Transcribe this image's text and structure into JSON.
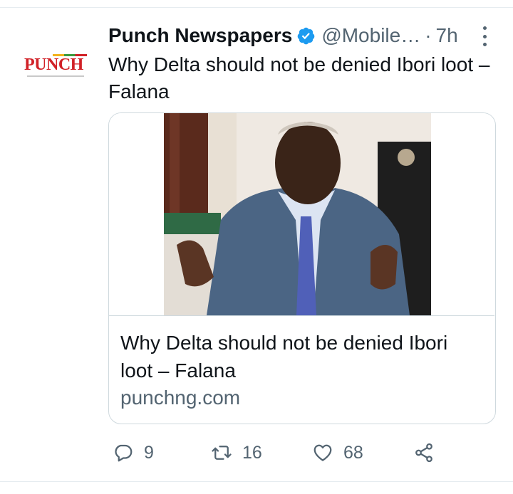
{
  "tweet": {
    "author_name": "Punch Newspapers",
    "handle": "@Mobile…",
    "separator": "·",
    "time": "7h",
    "text": "Why Delta should not be denied Ibori loot – Falana",
    "avatar_logo_text": "PUNCH"
  },
  "card": {
    "title": "Why Delta should not be denied Ibori loot – Falana",
    "domain": "punchng.com"
  },
  "actions": {
    "reply_count": "9",
    "retweet_count": "16",
    "like_count": "68"
  },
  "icons": {
    "verified": "verified-badge-icon",
    "more": "more-vertical-icon",
    "reply": "reply-icon",
    "retweet": "retweet-icon",
    "like": "heart-icon",
    "share": "share-icon"
  },
  "colors": {
    "text_primary": "#0f1419",
    "text_secondary": "#536471",
    "verified_blue": "#1d9bf0",
    "border": "#cfd9de",
    "punch_red": "#d12127"
  }
}
